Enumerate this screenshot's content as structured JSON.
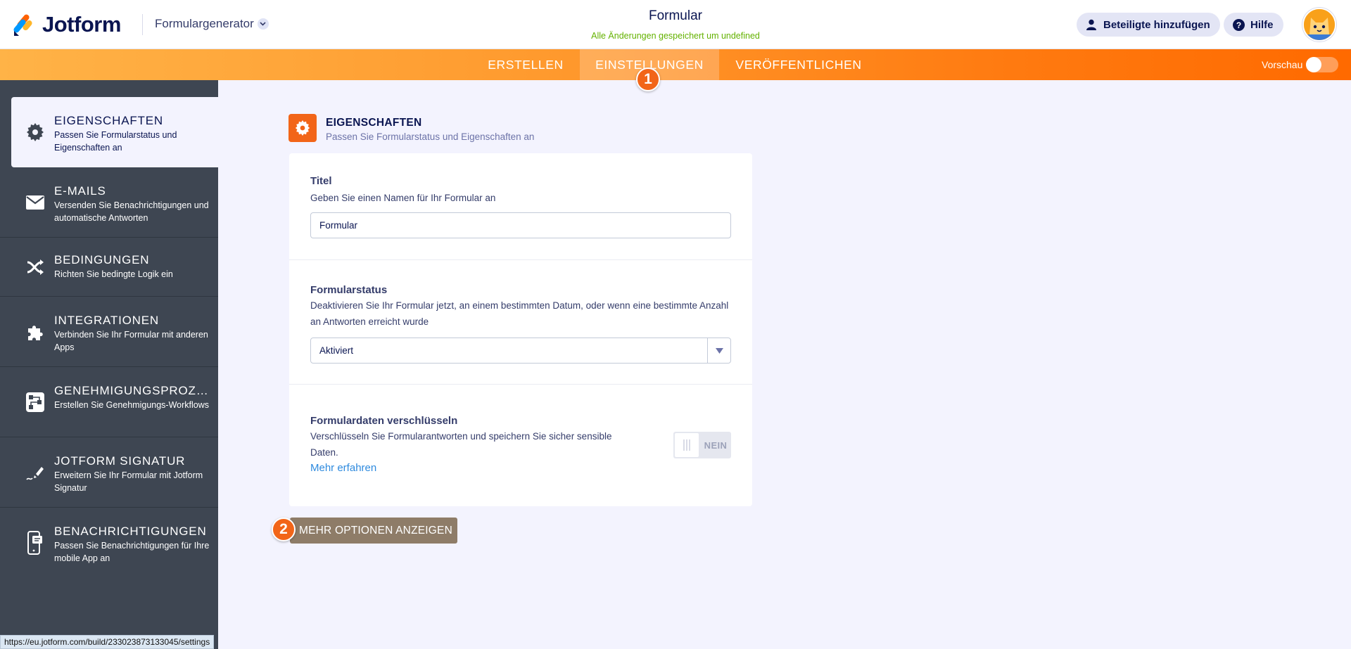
{
  "header": {
    "logo_text": "Jotform",
    "form_builder_label": "Formulargenerator",
    "form_title": "Formular",
    "save_status": "Alle Änderungen gespeichert um undefined",
    "add_collaborators_label": "Beteiligte hinzufügen",
    "help_label": "Hilfe"
  },
  "nav": {
    "tabs": [
      {
        "label": "ERSTELLEN"
      },
      {
        "label": "EINSTELLUNGEN"
      },
      {
        "label": "VERÖFFENTLICHEN"
      }
    ],
    "active_tab": "EINSTELLUNGEN",
    "preview_label": "Vorschau",
    "preview_enabled": false
  },
  "badges": {
    "one": "1",
    "two": "2"
  },
  "sidebar": {
    "items": [
      {
        "title": "EIGENSCHAFTEN",
        "desc": "Passen Sie Formularstatus und Eigenschaften an",
        "icon": "gear-icon"
      },
      {
        "title": "E-MAILS",
        "desc": "Versenden Sie Benachrichtigungen und automatische Antworten",
        "icon": "envelope-icon"
      },
      {
        "title": "BEDINGUNGEN",
        "desc": "Richten Sie bedingte Logik ein",
        "icon": "shuffle-icon"
      },
      {
        "title": "INTEGRATIONEN",
        "desc": "Verbinden Sie Ihr Formular mit anderen Apps",
        "icon": "puzzle-icon"
      },
      {
        "title": "GENEHMIGUNGSPROZES...",
        "desc": "Erstellen Sie Genehmigungs-Workflows",
        "icon": "flow-icon"
      },
      {
        "title": "JOTFORM SIGNATUR",
        "desc": "Erweitern Sie Ihr Formular mit Jotform Signatur",
        "icon": "pen-icon"
      },
      {
        "title": "BENACHRICHTIGUNGEN",
        "desc": "Passen Sie Benachrichtigungen für Ihre mobile App an",
        "icon": "phone-icon"
      }
    ]
  },
  "section": {
    "title": "EIGENSCHAFTEN",
    "subtitle": "Passen Sie Formularstatus und Eigenschaften an"
  },
  "fields": {
    "title": {
      "label": "Titel",
      "desc": "Geben Sie einen Namen für Ihr Formular an",
      "value": "Formular"
    },
    "status": {
      "label": "Formularstatus",
      "desc": "Deaktivieren Sie Ihr Formular jetzt, an einem bestimmten Datum, oder wenn eine bestimmte Anzahl an Antworten erreicht wurde",
      "value": "Aktiviert"
    },
    "encrypt": {
      "label": "Formulardaten verschlüsseln",
      "desc": "Verschlüsseln Sie Formularantworten und speichern Sie sicher sensible Daten.",
      "link": "Mehr erfahren",
      "toggle_label": "NEIN",
      "enabled": false
    }
  },
  "more_options_label": "MEHR OPTIONEN ANZEIGEN",
  "status_url": "https://eu.jotform.com/build/233023873133045/settings",
  "colors": {
    "brand_orange": "#ff6100",
    "sidebar_bg": "#3e4652",
    "accent_link": "#2e8ade",
    "save_green": "#64b200"
  }
}
